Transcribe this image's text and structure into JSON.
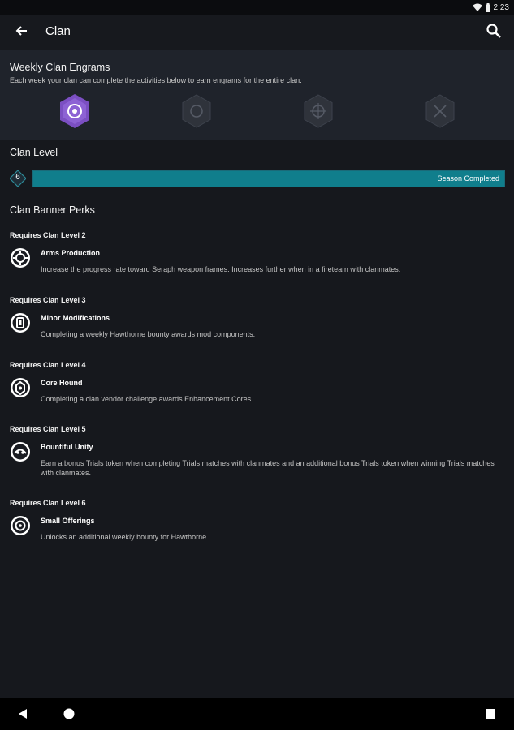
{
  "status_bar": {
    "time": "2:23",
    "icons": [
      "wifi-icon",
      "battery-icon"
    ]
  },
  "app_bar": {
    "title": "Clan",
    "back_icon": "arrow-back-icon",
    "search_icon": "search-icon"
  },
  "engrams": {
    "title": "Weekly Clan Engrams",
    "description": "Each week your clan can complete the activities below to earn engrams for the entire clan.",
    "items": [
      {
        "icon": "raid-engram-icon",
        "active": true
      },
      {
        "icon": "crucible-engram-icon",
        "active": false
      },
      {
        "icon": "strike-engram-icon",
        "active": false
      },
      {
        "icon": "gambit-engram-icon",
        "active": false
      }
    ],
    "colors": {
      "active": "#7b4fc2",
      "inactive": "#3a3e47"
    }
  },
  "clan_level": {
    "title": "Clan Level",
    "level": "6",
    "progress": 1.0,
    "progress_label": "Season Completed",
    "bar_color": "#107e8c"
  },
  "perks": {
    "title": "Clan Banner Perks",
    "groups": [
      {
        "requirement": "Requires Clan Level 2",
        "name": "Arms Production",
        "description": "Increase the progress rate toward Seraph weapon frames. Increases further when in a fireteam with clanmates.",
        "icon": "arms-production-icon"
      },
      {
        "requirement": "Requires Clan Level 3",
        "name": "Minor Modifications",
        "description": "Completing a weekly Hawthorne bounty awards mod components.",
        "icon": "minor-modifications-icon"
      },
      {
        "requirement": "Requires Clan Level 4",
        "name": "Core Hound",
        "description": "Completing a clan vendor challenge awards Enhancement Cores.",
        "icon": "core-hound-icon"
      },
      {
        "requirement": "Requires Clan Level 5",
        "name": "Bountiful Unity",
        "description": "Earn a bonus Trials token when completing Trials matches with clanmates and an additional bonus Trials token when winning Trials matches with clanmates.",
        "icon": "bountiful-unity-icon"
      },
      {
        "requirement": "Requires Clan Level 6",
        "name": "Small Offerings",
        "description": "Unlocks an additional weekly bounty for Hawthorne.",
        "icon": "small-offerings-icon"
      }
    ]
  },
  "nav_bar": {
    "back": "nav-back-icon",
    "home": "nav-home-icon",
    "recents": "nav-recents-icon"
  }
}
